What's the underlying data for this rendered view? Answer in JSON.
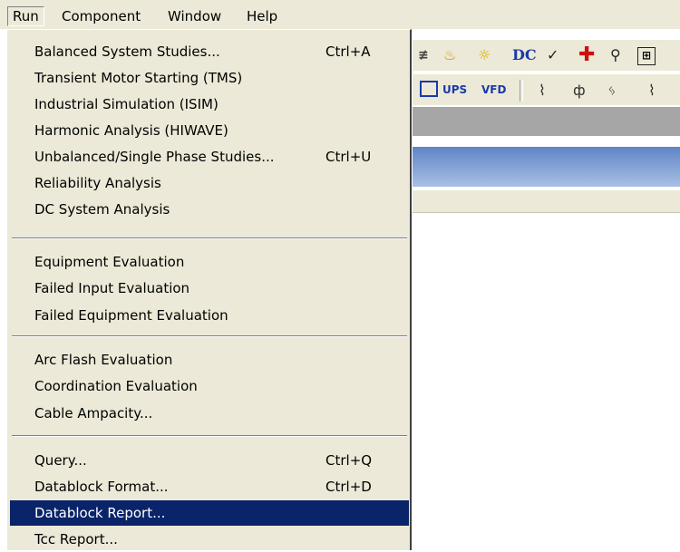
{
  "menubar": {
    "items": [
      {
        "label": "Run"
      },
      {
        "label": "Component"
      },
      {
        "label": "Window"
      },
      {
        "label": "Help"
      }
    ]
  },
  "toolbar": {
    "dc_label": "DC",
    "ups_label": "UPS",
    "vfd_label": "VFD"
  },
  "run_menu": {
    "groups": [
      [
        {
          "label": "Balanced System Studies...",
          "shortcut": "Ctrl+A"
        },
        {
          "label": "Transient Motor Starting (TMS)",
          "shortcut": ""
        },
        {
          "label": "Industrial Simulation (ISIM)",
          "shortcut": ""
        },
        {
          "label": "Harmonic Analysis (HIWAVE)",
          "shortcut": ""
        },
        {
          "label": "Unbalanced/Single Phase Studies...",
          "shortcut": "Ctrl+U"
        },
        {
          "label": "Reliability Analysis",
          "shortcut": ""
        },
        {
          "label": "DC System Analysis",
          "shortcut": ""
        }
      ],
      [
        {
          "label": "Equipment Evaluation",
          "shortcut": ""
        },
        {
          "label": "Failed Input Evaluation",
          "shortcut": ""
        },
        {
          "label": "Failed Equipment Evaluation",
          "shortcut": ""
        }
      ],
      [
        {
          "label": "Arc Flash Evaluation",
          "shortcut": ""
        },
        {
          "label": "Coordination Evaluation",
          "shortcut": ""
        },
        {
          "label": "Cable Ampacity...",
          "shortcut": ""
        }
      ],
      [
        {
          "label": "Query...",
          "shortcut": "Ctrl+Q"
        },
        {
          "label": "Datablock Format...",
          "shortcut": "Ctrl+D"
        },
        {
          "label": "Datablock Report...",
          "shortcut": ""
        },
        {
          "label": "Tcc Report...",
          "shortcut": ""
        }
      ]
    ],
    "highlighted": "Datablock Report...",
    "highlight_color": "#0a246a"
  }
}
